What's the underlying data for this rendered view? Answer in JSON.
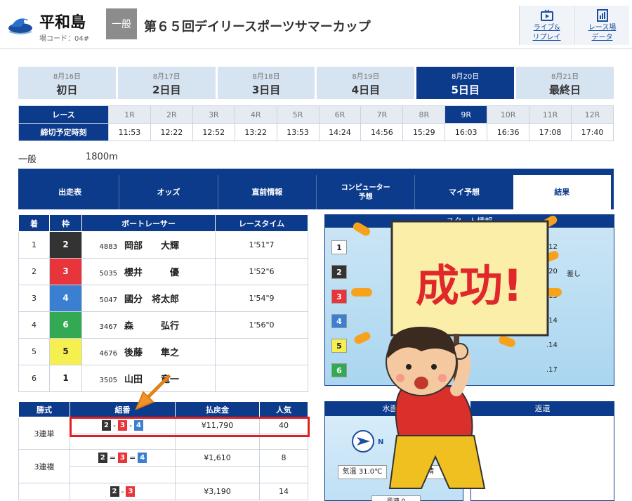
{
  "header": {
    "venue": "平和島",
    "venue_code": "場コード：04#",
    "grade": "一般",
    "title": "第６５回デイリースポーツサマーカップ",
    "btn_live_label_1": "ライブ&",
    "btn_live_label_2": "リプレイ",
    "btn_data_label_1": "レース場",
    "btn_data_label_2": "データ"
  },
  "days": [
    {
      "date": "8月16日",
      "name": "初日"
    },
    {
      "date": "8月17日",
      "name": "2日目"
    },
    {
      "date": "8月18日",
      "name": "3日目"
    },
    {
      "date": "8月19日",
      "name": "4日目"
    },
    {
      "date": "8月20日",
      "name": "5日目"
    },
    {
      "date": "8月21日",
      "name": "最終日"
    }
  ],
  "active_day_index": 4,
  "schedule": {
    "race_label": "レース",
    "time_label": "締切予定時刻",
    "races": [
      "1R",
      "2R",
      "3R",
      "4R",
      "5R",
      "6R",
      "7R",
      "8R",
      "9R",
      "10R",
      "11R",
      "12R"
    ],
    "times": [
      "11:53",
      "12:22",
      "12:52",
      "13:22",
      "13:53",
      "14:24",
      "14:56",
      "15:29",
      "16:03",
      "16:36",
      "17:08",
      "17:40"
    ],
    "active_index": 8
  },
  "race_info": {
    "class": "一般",
    "distance": "1800m"
  },
  "nav_tabs": [
    "出走表",
    "オッズ",
    "直前情報",
    "コンピューター\n予想",
    "マイ予想",
    "結果"
  ],
  "nav_active": 5,
  "result": {
    "headers": [
      "着",
      "枠",
      "ボートレーサー",
      "レースタイム"
    ],
    "rows": [
      {
        "pos": "1",
        "waku": "2",
        "reg": "4883",
        "name": "岡部　　大輝",
        "time": "1'51\"7"
      },
      {
        "pos": "2",
        "waku": "3",
        "reg": "5035",
        "name": "櫻井　　　優",
        "time": "1'52\"6"
      },
      {
        "pos": "3",
        "waku": "4",
        "reg": "5047",
        "name": "國分　将太郎",
        "time": "1'54\"9"
      },
      {
        "pos": "4",
        "waku": "6",
        "reg": "3467",
        "name": "森　　　弘行",
        "time": "1'56\"0"
      },
      {
        "pos": "5",
        "waku": "5",
        "reg": "4676",
        "name": "後藤　　隼之",
        "time": ""
      },
      {
        "pos": "6",
        "waku": "1",
        "reg": "3505",
        "name": "山田　　竜一",
        "time": ""
      }
    ]
  },
  "start_info": {
    "title": "スタート情報",
    "boats": [
      "1",
      "2",
      "3",
      "4",
      "5",
      "6"
    ],
    "times": [
      ".12",
      ".20",
      ".15",
      ".14",
      ".14",
      ".17"
    ],
    "note": "差し"
  },
  "payout": {
    "headers": [
      "勝式",
      "組番",
      "払戻金",
      "人気"
    ],
    "rows": [
      {
        "type": "3連単",
        "combo": [
          "2",
          "3",
          "4"
        ],
        "sep": "-",
        "amount": "¥11,790",
        "pop": "40"
      },
      {
        "type": "3連複",
        "combo": [
          "2",
          "3",
          "4"
        ],
        "sep": "=",
        "amount": "¥1,610",
        "pop": "8"
      },
      {
        "type": "",
        "combo": [
          "2",
          "3"
        ],
        "sep": "-",
        "amount": "¥3,190",
        "pop": "14"
      }
    ]
  },
  "water": {
    "title": "水面気",
    "wind_dir": "N",
    "temp": "気温 31.0℃",
    "weather": "晴",
    "wave_label": "風速 0"
  },
  "return_panel": {
    "title": "返還"
  },
  "illustration": {
    "sign_text": "成功!"
  },
  "colors": {
    "navy": "#0d3b8c",
    "highlight": "#e02020"
  }
}
